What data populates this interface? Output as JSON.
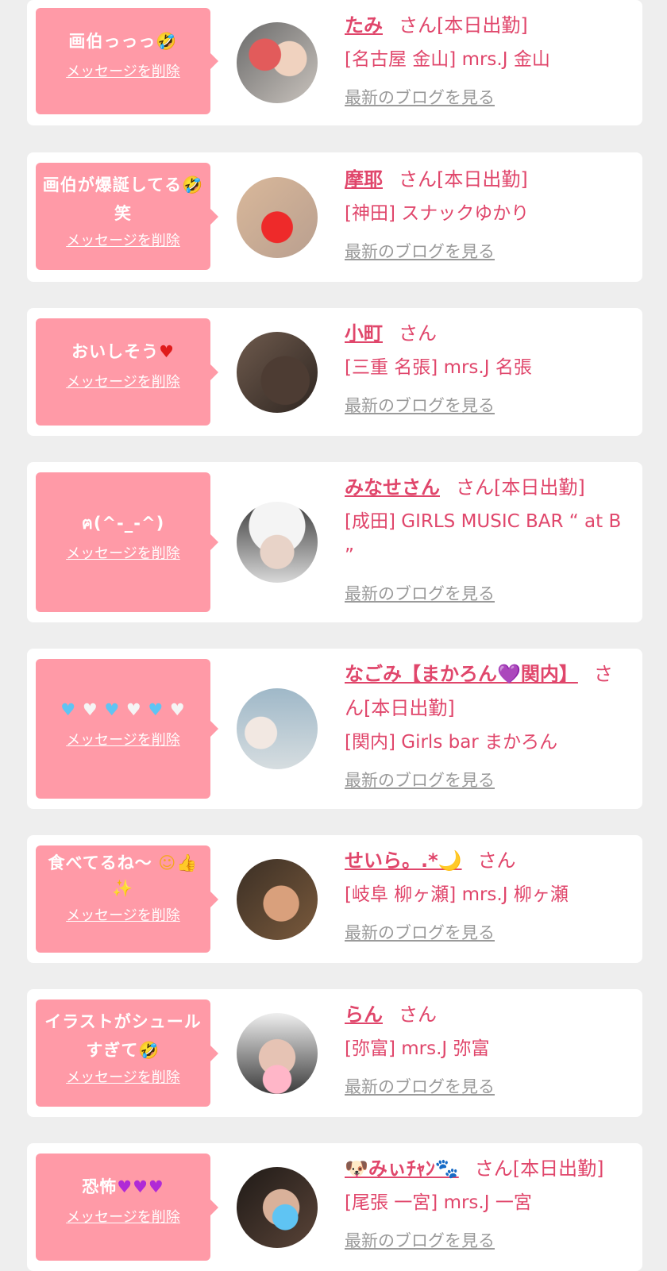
{
  "delete_label": "メッセージを削除",
  "blog_label": "最新のブログを見る",
  "san_label": "さん",
  "colors": {
    "bubble": "#ff9aa7",
    "accent": "#e0466b",
    "link_gray": "#9a9a9a",
    "background": "#eeeeee"
  },
  "items": [
    {
      "message": "画伯っっっ",
      "message_icon": "rofl-emoji",
      "name": "たみ",
      "status": "[本日出勤]",
      "shop": "[名古屋 金山] mrs.J 金山"
    },
    {
      "message": "画伯が爆誕してる",
      "message_icon": "rofl-emoji",
      "message_suffix": "笑",
      "name": "摩耶",
      "status": "[本日出勤]",
      "shop": "[神田] スナックゆかり"
    },
    {
      "message": "おいしそう",
      "message_icon": "red-heart-emoji",
      "name": "小町",
      "status": "",
      "shop": "[三重 名張] mrs.J 名張"
    },
    {
      "message": "ฅ(^-_-^)",
      "name": "みなせさん",
      "status": "[本日出勤]",
      "shop": "[成田] GIRLS MUSIC BAR “ at B ”"
    },
    {
      "message": "💙🤍💙🤍💙🤍",
      "name": "なごみ【まかろん💜関内】",
      "status": "[本日出勤]",
      "shop": "[関内] Girls bar まかろん"
    },
    {
      "message": "食べてるね〜",
      "message_icon": "smile-thumbs-sparkles-emoji",
      "name": "せいら。.*🌙",
      "status": "",
      "shop": "[岐阜 柳ヶ瀬] mrs.J 柳ヶ瀬"
    },
    {
      "message": "イラストがシュールすぎて",
      "message_icon": "rofl-emoji",
      "name": "らん",
      "status": "",
      "shop": "[弥富] mrs.J 弥富"
    },
    {
      "message": "恐怖",
      "message_icon": "purple-hearts-emoji",
      "name": "🐶みぃﾁｬﾝ🐾",
      "status": "[本日出勤]",
      "shop": "[尾張 一宮] mrs.J 一宮"
    }
  ]
}
